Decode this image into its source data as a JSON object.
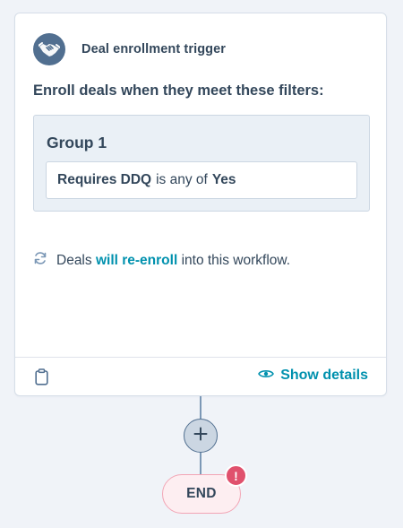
{
  "trigger": {
    "title": "Deal enrollment trigger",
    "icon": "handshake-icon"
  },
  "enroll_text": "Enroll deals when they meet these filters:",
  "group": {
    "title": "Group 1",
    "filter": {
      "property": "Requires DDQ",
      "operator": "is any of",
      "value": "Yes"
    }
  },
  "reenroll": {
    "prefix": "Deals",
    "link": "will re-enroll",
    "suffix": "into this workflow.",
    "icon": "refresh-icon"
  },
  "footer": {
    "show_details_label": "Show details",
    "left_icon": "clipboard-icon",
    "details_icon": "eye-icon"
  },
  "end": {
    "label": "END",
    "alert": "!"
  },
  "colors": {
    "accent": "#0091ae",
    "text": "#33475b",
    "group_bg": "#eaf0f6",
    "end_bg": "#fdeef1",
    "alert": "#e0516d"
  }
}
